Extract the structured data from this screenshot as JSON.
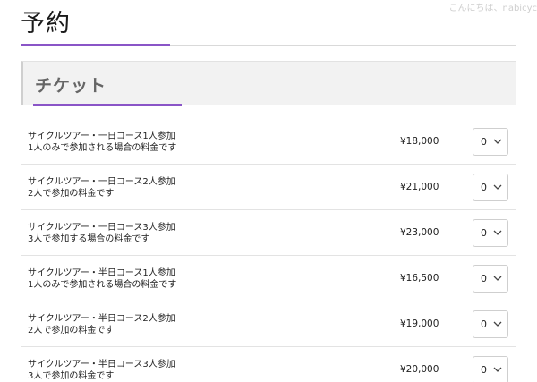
{
  "header": {
    "greeting": "こんにちは、nabicyc",
    "title": "予約"
  },
  "section": {
    "title": "チケット"
  },
  "tickets": [
    {
      "name": "サイクルツアー・一日コース1人参加",
      "description": "1人のみで参加される場合の料金です",
      "price": "¥18,000",
      "quantity": "0"
    },
    {
      "name": "サイクルツアー・一日コース2人参加",
      "description": "2人で参加の料金です",
      "price": "¥21,000",
      "quantity": "0"
    },
    {
      "name": "サイクルツアー・一日コース3人参加",
      "description": "3人で参加する場合の料金です",
      "price": "¥23,000",
      "quantity": "0"
    },
    {
      "name": "サイクルツアー・半日コース1人参加",
      "description": "1人のみで参加される場合の料金です",
      "price": "¥16,500",
      "quantity": "0"
    },
    {
      "name": "サイクルツアー・半日コース2人参加",
      "description": "2人で参加の料金です",
      "price": "¥19,000",
      "quantity": "0"
    },
    {
      "name": "サイクルツアー・半日コース3人参加",
      "description": "3人で参加の料金です",
      "price": "¥20,000",
      "quantity": "0"
    }
  ],
  "colors": {
    "accent": "#8a55c7",
    "header_background": "#f2f2f2"
  },
  "icons": {
    "quantity_dropdown": "chevron-down-icon"
  }
}
